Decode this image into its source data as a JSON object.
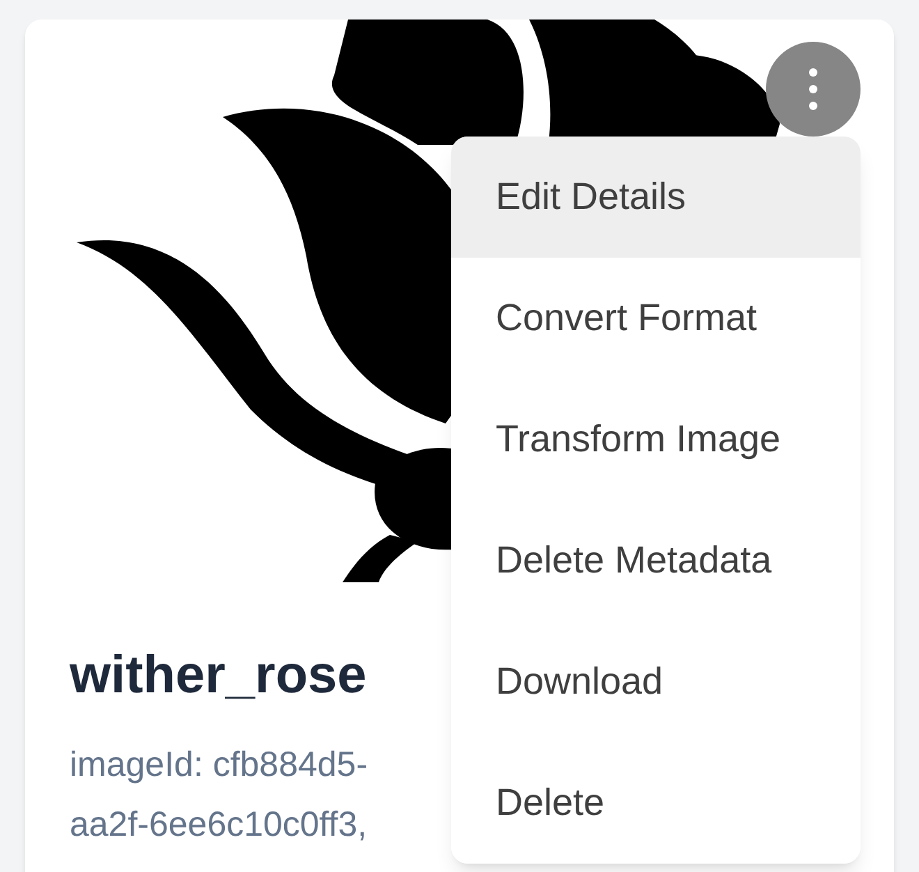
{
  "card": {
    "title": "wither_rose",
    "description_lines": [
      "imageId: cfb884d5-",
      "aa2f-6ee6c10c0ff3,"
    ],
    "menu": {
      "items": [
        {
          "label": "Edit Details",
          "selected": true
        },
        {
          "label": "Convert Format",
          "selected": false
        },
        {
          "label": "Transform Image",
          "selected": false
        },
        {
          "label": "Delete Metadata",
          "selected": false
        },
        {
          "label": "Download",
          "selected": false
        },
        {
          "label": "Delete",
          "selected": false
        }
      ]
    }
  }
}
